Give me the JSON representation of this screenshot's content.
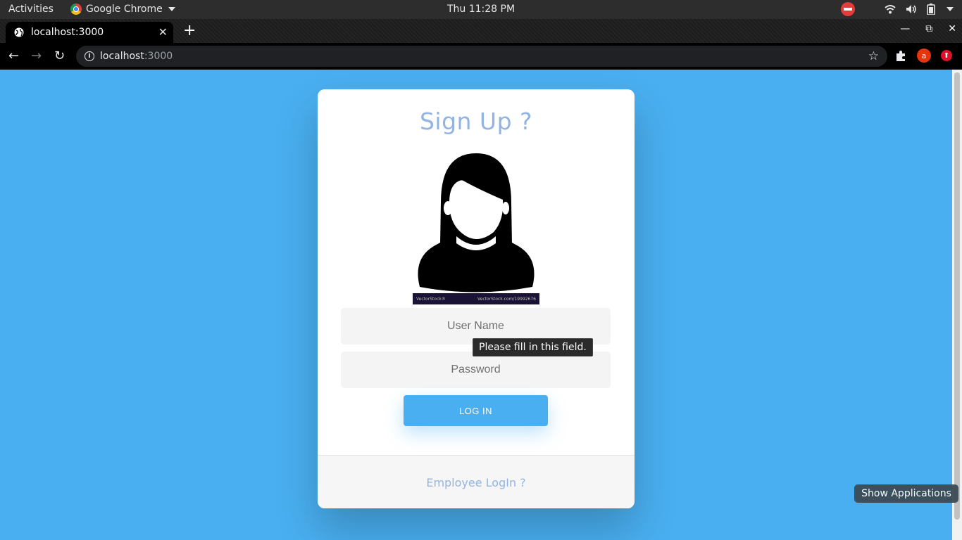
{
  "system_bar": {
    "activities": "Activities",
    "app_name": "Google Chrome",
    "clock": "Thu 11:28 PM"
  },
  "browser": {
    "tab_title": "localhost:3000",
    "url_host": "localhost",
    "url_port": ":3000",
    "profile_initial": "a"
  },
  "form": {
    "title": "Sign Up ?",
    "username_placeholder": "User Name",
    "password_placeholder": "Password",
    "login_label": "LOG IN",
    "footer_link": "Employee LogIn ?",
    "validation_tooltip": "Please fill in this field.",
    "image_watermark_left": "VectorStock®",
    "image_watermark_right": "VectorStock.com/19992676"
  },
  "desktop": {
    "show_applications": "Show Applications"
  },
  "colors": {
    "page_bg": "#49aff0",
    "title": "#92b4e2",
    "button": "#49aff0"
  }
}
